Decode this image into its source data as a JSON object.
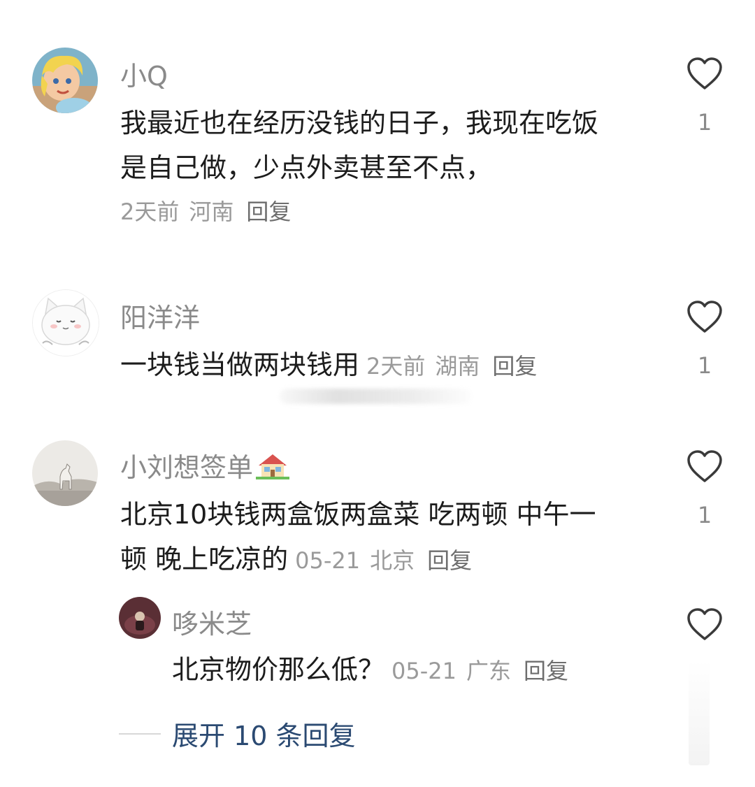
{
  "comments": [
    {
      "username": "小Q",
      "text_lines": [
        "我最近也在经历没钱的日子，我现在吃饭",
        "是自己做，少点外卖甚至不点，"
      ],
      "time": "2天前",
      "location": "河南",
      "reply_label": "回复",
      "likes": "1",
      "avatar_icon": "cartoon-girl-avatar"
    },
    {
      "username": "阳洋洋",
      "text_lines": [
        "一块钱当做两块钱用"
      ],
      "time": "2天前",
      "location": "湖南",
      "reply_label": "回复",
      "likes": "1",
      "avatar_icon": "white-cat-avatar"
    },
    {
      "username": "小刘想签单",
      "username_emoji": "house-emoji",
      "text_lines": [
        "北京10块钱两盒饭两盒菜 吃两顿 中午一",
        "顿 晚上吃凉的"
      ],
      "time": "05-21",
      "location": "北京",
      "reply_label": "回复",
      "likes": "1",
      "avatar_icon": "horse-landscape-avatar"
    }
  ],
  "sub_reply": {
    "username": "哆米芝",
    "text": "北京物价那么低？",
    "time": "05-21",
    "location": "广东",
    "reply_label": "回复",
    "avatar_icon": "dark-photo-avatar"
  },
  "expand": {
    "label": "展开 10 条回复"
  },
  "colors": {
    "username": "#8a8a8a",
    "meta": "#9a9a9a",
    "expand_link": "#2b4a72",
    "heart_outline": "#3a3a3a"
  }
}
